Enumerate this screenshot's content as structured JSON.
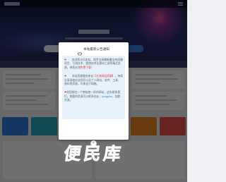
{
  "colors": {
    "accent": "#3d7de0",
    "notice_bg": "#e6f1fb",
    "highlight_red": "#e0383e",
    "link_blue": "#2f7fdc",
    "watermark": "#5db6ea"
  },
  "modal": {
    "title_icon": "diamond-icon",
    "title": "本站最新公告通知",
    "notices": [
      {
        "heart": "❤",
        "text": "　　欢迎您访问本站，网罗全网最新最全的网赚项目、引流技术、营销技术及建站工具等精品资源，带您在线",
        "highlight": "免费下载！"
      },
      {
        "heart": "❤",
        "text": "　　本站资源整合来自",
        "highlight": "【交流网站资源】",
        "text_after": "，持续分享网络实战项目以及个人网站、软件、工具、源码等资源，均来自于网络。"
      },
      {
        "heart": "❤",
        "text": "如您想在一个审核地一样的网站，应先联系我们，想要的资源可以联系站长：",
        "link": "lyingplus",
        "text_after": "，加群交流。"
      }
    ],
    "close_icon": "close-icon",
    "close_glyph": "×"
  },
  "watermark": {
    "text": "便民库"
  }
}
